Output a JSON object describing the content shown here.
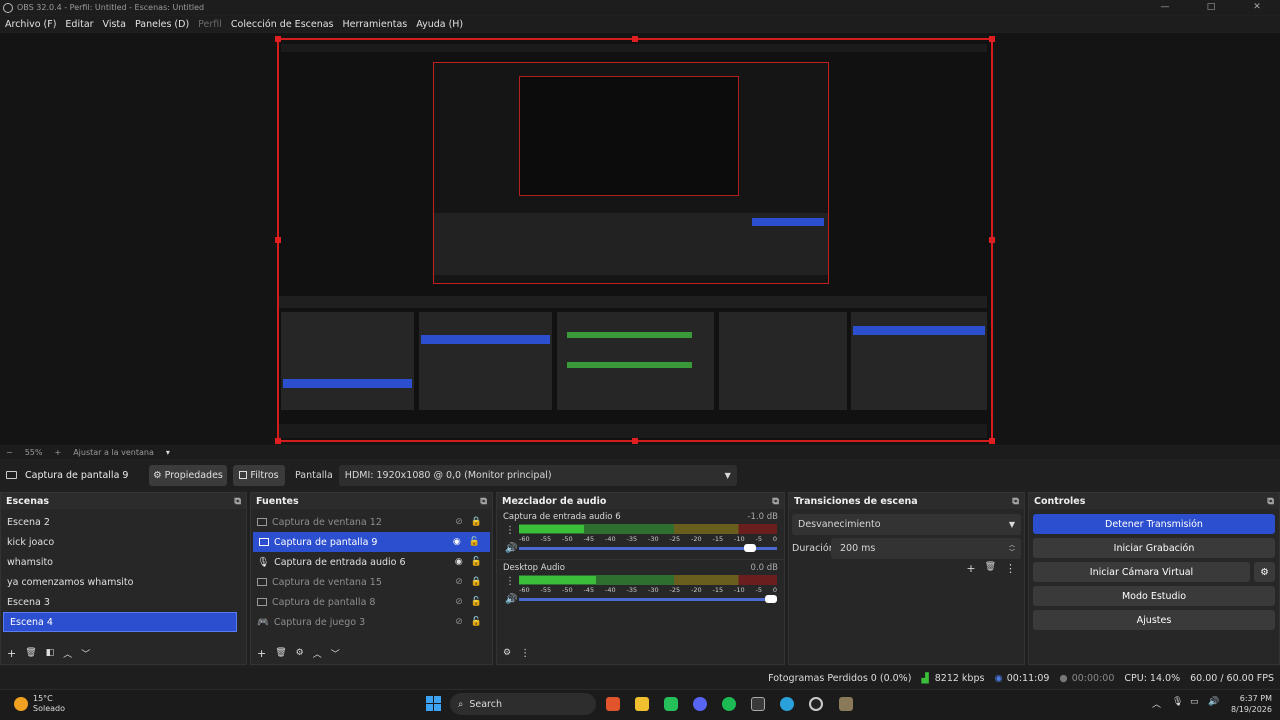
{
  "window": {
    "title": "OBS 32.0.4 - Perfil: Untitled - Escenas: Untitled",
    "controls": [
      "—",
      "□",
      "✕"
    ]
  },
  "menu": [
    {
      "label": "Archivo (F)",
      "enabled": true
    },
    {
      "label": "Editar",
      "enabled": true
    },
    {
      "label": "Vista",
      "enabled": true
    },
    {
      "label": "Paneles (D)",
      "enabled": true
    },
    {
      "label": "Perfil",
      "enabled": false
    },
    {
      "label": "Colección de Escenas",
      "enabled": true
    },
    {
      "label": "Herramientas",
      "enabled": true
    },
    {
      "label": "Ayuda (H)",
      "enabled": true
    }
  ],
  "zoom": {
    "minus": "−",
    "value": "55%",
    "plus": "+",
    "fit": "Ajustar a la ventana",
    "arrow": "▾"
  },
  "source_bar": {
    "source_name": "Captura de pantalla 9",
    "properties": "Propiedades",
    "filters": "Filtros",
    "display_label": "Pantalla",
    "display_value": "HDMI: 1920x1080 @ 0,0 (Monitor principal)"
  },
  "scenes": {
    "title": "Escenas",
    "items": [
      {
        "label": "Escena 2",
        "selected": false
      },
      {
        "label": "kick joaco",
        "selected": false
      },
      {
        "label": "whamsito",
        "selected": false
      },
      {
        "label": "ya comenzamos whamsito",
        "selected": false
      },
      {
        "label": "Escena 3",
        "selected": false
      },
      {
        "label": "Escena 4",
        "selected": true
      }
    ]
  },
  "sources": {
    "title": "Fuentes",
    "items": [
      {
        "label": "Captura de ventana 12",
        "icon": "window-icon",
        "visible": false,
        "locked": true,
        "selected": false
      },
      {
        "label": "Captura de pantalla 9",
        "icon": "monitor-icon",
        "visible": true,
        "locked": false,
        "selected": true
      },
      {
        "label": "Captura de entrada audio 6",
        "icon": "microphone-icon",
        "visible": true,
        "locked": false,
        "selected": false
      },
      {
        "label": "Captura de ventana 15",
        "icon": "window-icon",
        "visible": false,
        "locked": true,
        "selected": false
      },
      {
        "label": "Captura de pantalla 8",
        "icon": "monitor-icon",
        "visible": false,
        "locked": false,
        "selected": false
      },
      {
        "label": "Captura de juego 3",
        "icon": "gamepad-icon",
        "visible": false,
        "locked": false,
        "selected": false
      }
    ]
  },
  "mixer": {
    "title": "Mezclador de audio",
    "scale": [
      "-60",
      "-55",
      "-50",
      "-45",
      "-40",
      "-35",
      "-30",
      "-25",
      "-20",
      "-15",
      "-10",
      "-5",
      "0"
    ],
    "channels": [
      {
        "name": "Captura de entrada audio 6",
        "db": "-1.0 dB",
        "level": 0.25,
        "volume": 0.92
      },
      {
        "name": "Desktop Audio",
        "db": "0.0 dB",
        "level": 0.3,
        "volume": 1.0
      }
    ]
  },
  "transitions": {
    "title": "Transiciones de escena",
    "type": "Desvanecimiento",
    "duration_label": "Duración",
    "duration": "200 ms"
  },
  "controls": {
    "title": "Controles",
    "buttons": [
      {
        "label": "Detener Transmisión",
        "active": true
      },
      {
        "label": "Iniciar Grabación",
        "active": false
      },
      {
        "label": "Iniciar Cámara Virtual",
        "active": false
      },
      {
        "label": "Modo Estudio",
        "active": false
      },
      {
        "label": "Ajustes",
        "active": false
      }
    ]
  },
  "status": {
    "dropped": "Fotogramas Perdidos 0 (0.0%)",
    "bitrate": "8212 kbps",
    "stream_time": "00:11:09",
    "rec_time": "00:00:00",
    "cpu": "CPU: 14.0%",
    "fps": "60.00 / 60.00 FPS"
  },
  "taskbar": {
    "weather_temp": "15°C",
    "weather_desc": "Soleado",
    "search": "Search",
    "time": "6:37 PM",
    "date": "8/19/2026",
    "colors": {
      "accent": "#2c4fcf",
      "border": "#d51c1c",
      "meter": "#3bbf3b"
    }
  }
}
